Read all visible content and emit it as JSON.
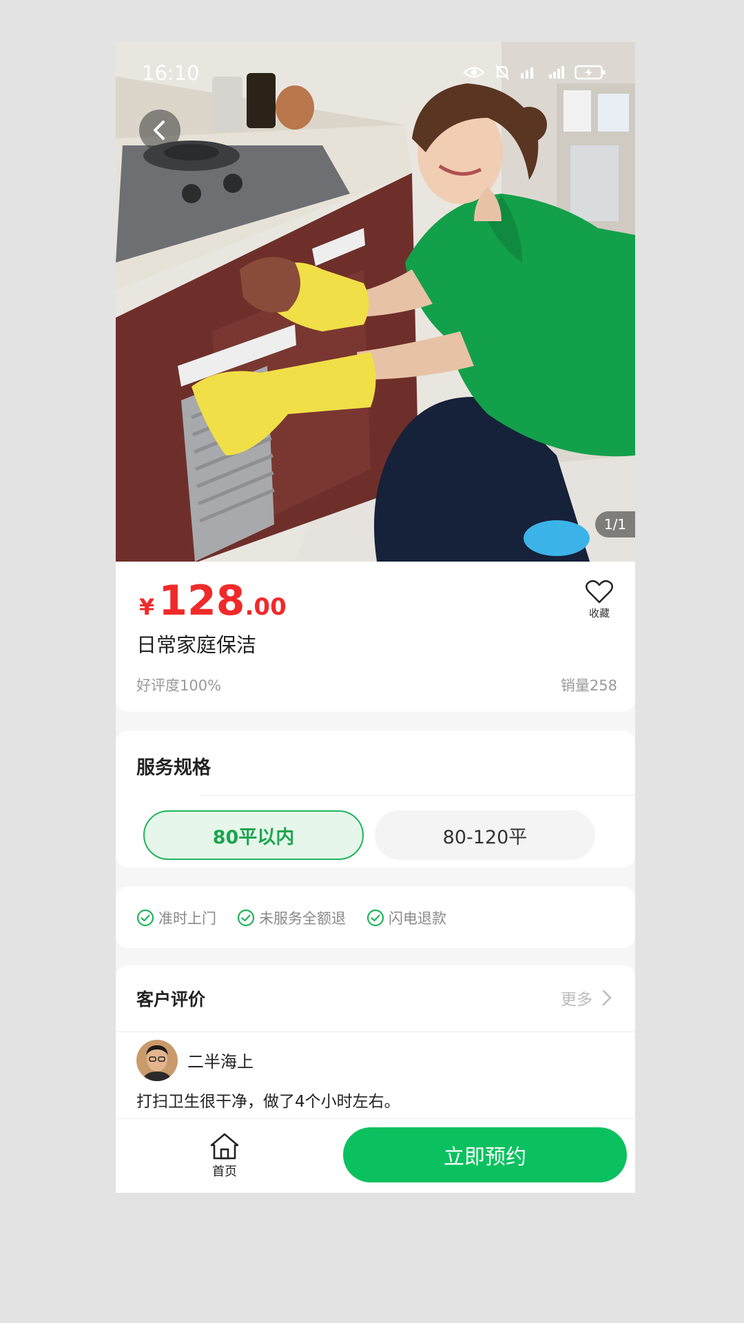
{
  "status_bar": {
    "time": "16:10"
  },
  "gallery": {
    "counter": "1/1"
  },
  "product": {
    "currency": "¥",
    "price_int": "128",
    "price_dec": ".00",
    "title": "日常家庭保洁",
    "rating": "好评度100%",
    "sales": "销量258",
    "favorite_label": "收藏"
  },
  "spec": {
    "heading": "服务规格",
    "options": [
      {
        "label": "80平以内",
        "selected": true
      },
      {
        "label": "80-120平",
        "selected": false
      }
    ]
  },
  "guarantees": [
    "准时上门",
    "未服务全额退",
    "闪电退款"
  ],
  "reviews": {
    "heading": "客户评价",
    "more_label": "更多",
    "items": [
      {
        "user": "二半海上",
        "text": "打扫卫生很干净，做了4个小时左右。"
      }
    ]
  },
  "bottom_bar": {
    "home_label": "首页",
    "book_label": "立即预约"
  },
  "colors": {
    "price": "#f02a2a",
    "accent": "#0bc15f",
    "selected_border": "#1fb45a"
  }
}
